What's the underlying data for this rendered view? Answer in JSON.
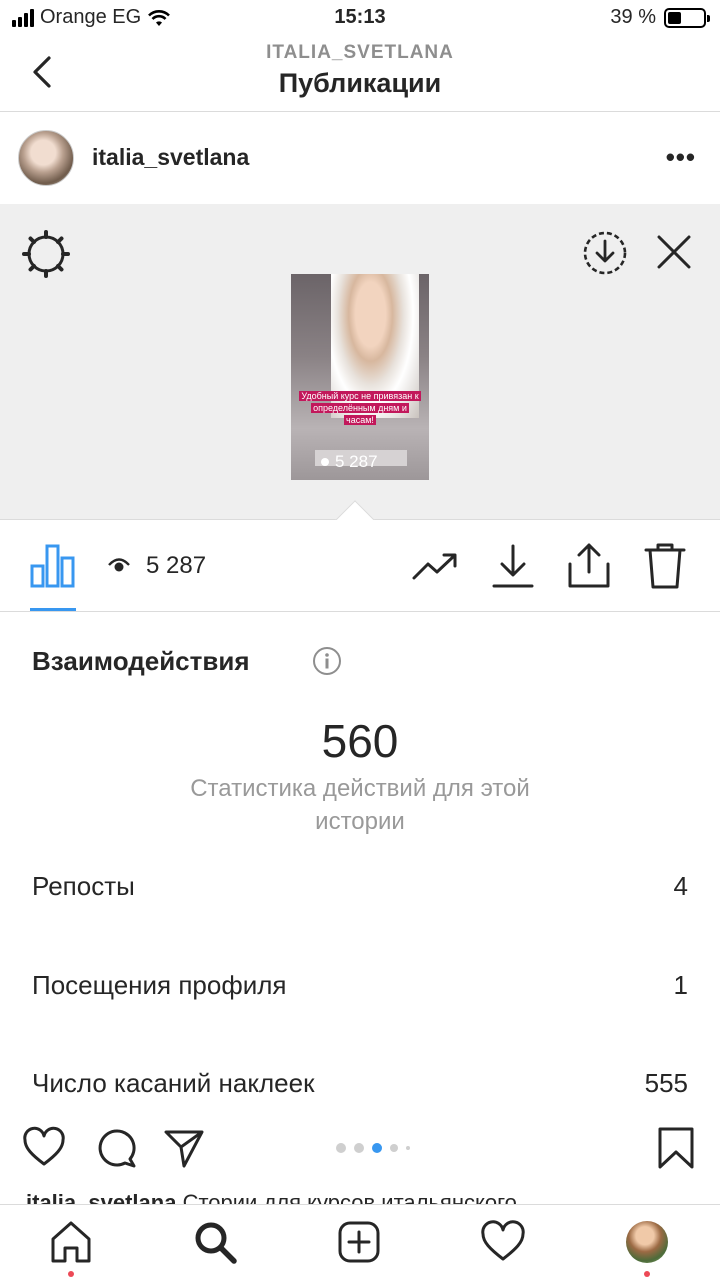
{
  "status_bar": {
    "carrier": "Orange EG",
    "time": "15:13",
    "battery_text": "39 %",
    "battery_level": 0.39
  },
  "nav": {
    "subtitle": "ITALIA_SVETLANA",
    "title": "Публикации"
  },
  "post": {
    "username": "italia_svetlana",
    "more_label": "•••"
  },
  "story": {
    "caption": "Удобный курс не привязан к определённым дням и часам!",
    "views_overlay": "5 287"
  },
  "toolbar": {
    "views": "5 287"
  },
  "insights": {
    "section_title": "Взаимодействия",
    "total": "560",
    "total_caption": "Статистика действий для этой истории",
    "rows": [
      {
        "label": "Репосты",
        "value": "4"
      },
      {
        "label": "Посещения профиля",
        "value": "1"
      },
      {
        "label": "Число касаний наклеек",
        "value": "555"
      }
    ]
  },
  "caption_peek": {
    "username": "italia_svetlana",
    "text": "Стории для курсов итальянского"
  },
  "carousel": {
    "count": 5,
    "active_index": 2
  },
  "colors": {
    "accent": "#3897f0",
    "story_caption_bg": "#c2185b",
    "notification_dot": "#ed4956"
  }
}
